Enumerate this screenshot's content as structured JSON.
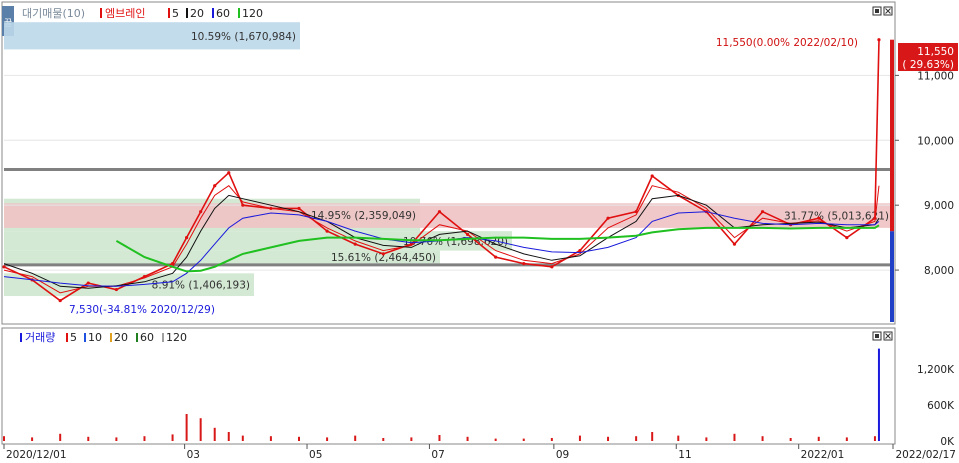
{
  "window": {
    "side_tab": "꿀"
  },
  "price_panel": {
    "legend": {
      "prefix": "대기매물(10)",
      "name": "엠브레인",
      "ma": [
        {
          "label": "5",
          "color": "#e01010"
        },
        {
          "label": "20",
          "color": "#111111"
        },
        {
          "label": "60",
          "color": "#1a1adc"
        },
        {
          "label": "120",
          "color": "#20c020"
        }
      ]
    },
    "y_ticks": [
      "11,000",
      "10,000",
      "9,000",
      "8,000"
    ],
    "current_price": {
      "price": "11,550",
      "change": "( 29.63%)"
    },
    "max_annotation": "11,550(0.00% 2022/02/10)",
    "min_annotation": "7,530(-34.81% 2020/12/29)",
    "volume_profile": [
      {
        "range": [
          11400,
          11820
        ],
        "label": "10.59% (1,670,984)",
        "color": "#bcd8ea"
      },
      {
        "range": [
          8600,
          9100
        ],
        "label": "14.95% (2,359,049)",
        "color": "#cfe7cf"
      },
      {
        "range": [
          8650,
          9030
        ],
        "label": "31.77% (5,013,621)",
        "color": "#f0c2c4"
      },
      {
        "range": [
          8300,
          8600
        ],
        "label": "10.76% (1,698,620)",
        "color": "#cfe7cf"
      },
      {
        "range": [
          8100,
          8300
        ],
        "label": "15.61% (2,464,450)",
        "color": "#cfe7cf"
      },
      {
        "range": [
          7600,
          7950
        ],
        "label": "8.91% (1,406,193)",
        "color": "#cfe7cf"
      }
    ],
    "support_lines": [
      9550,
      8080
    ],
    "price_axis_bar": "#2040c8"
  },
  "volume_panel": {
    "legend": {
      "name": "거래량",
      "ma": [
        {
          "label": "5",
          "color": "#e01010"
        },
        {
          "label": "10",
          "color": "#2050e0"
        },
        {
          "label": "20",
          "color": "#e0a020"
        },
        {
          "label": "60",
          "color": "#208020"
        },
        {
          "label": "120",
          "color": "#a0a0a0"
        }
      ]
    },
    "y_ticks": [
      "1,200K",
      "600K",
      "0K"
    ]
  },
  "x_ticks": [
    "2020/12/01",
    "03",
    "05",
    "07",
    "09",
    "11",
    "2022/01",
    "2022/02/17"
  ],
  "chart_data": {
    "type": "line",
    "title": "엠브레인",
    "ylabel": "",
    "xlabel": "",
    "ylim": [
      7200,
      12100
    ],
    "volume_ylim": [
      0,
      1600000
    ],
    "x": [
      "2020/12/01",
      "2020/12/15",
      "2020/12/29",
      "2021/01/12",
      "2021/01/26",
      "2021/02/09",
      "2021/02/23",
      "2021/03/02",
      "2021/03/09",
      "2021/03/16",
      "2021/03/23",
      "2021/03/30",
      "2021/04/13",
      "2021/04/27",
      "2021/05/11",
      "2021/05/25",
      "2021/06/08",
      "2021/06/22",
      "2021/07/06",
      "2021/07/20",
      "2021/08/03",
      "2021/08/17",
      "2021/08/31",
      "2021/09/14",
      "2021/09/28",
      "2021/10/12",
      "2021/10/20",
      "2021/11/02",
      "2021/11/16",
      "2021/11/30",
      "2021/12/14",
      "2021/12/28",
      "2022/01/11",
      "2022/01/25",
      "2022/02/08",
      "2022/02/10"
    ],
    "series": [
      {
        "name": "엠브레인",
        "color": "#e01010",
        "values": [
          8050,
          7850,
          7530,
          7800,
          7700,
          7900,
          8100,
          8500,
          8900,
          9300,
          9500,
          9000,
          8950,
          8950,
          8600,
          8400,
          8250,
          8400,
          8900,
          8550,
          8200,
          8100,
          8050,
          8300,
          8800,
          8900,
          9450,
          9150,
          8900,
          8400,
          8900,
          8700,
          8800,
          8500,
          8800,
          11550
        ]
      },
      {
        "name": "5",
        "color": "#e01010",
        "values": [
          8000,
          7900,
          7650,
          7750,
          7750,
          7880,
          8050,
          8400,
          8800,
          9150,
          9300,
          9050,
          8950,
          8900,
          8650,
          8450,
          8300,
          8380,
          8700,
          8600,
          8300,
          8150,
          8100,
          8250,
          8650,
          8850,
          9300,
          9200,
          8950,
          8500,
          8800,
          8720,
          8760,
          8600,
          8750,
          9300
        ]
      },
      {
        "name": "20",
        "color": "#111111",
        "values": [
          8100,
          7950,
          7750,
          7720,
          7760,
          7820,
          7950,
          8200,
          8600,
          8950,
          9150,
          9100,
          9000,
          8900,
          8750,
          8500,
          8380,
          8350,
          8550,
          8600,
          8400,
          8250,
          8150,
          8220,
          8500,
          8750,
          9100,
          9150,
          9000,
          8650,
          8700,
          8720,
          8740,
          8650,
          8700,
          8800
        ]
      },
      {
        "name": "60",
        "color": "#1a1adc",
        "values": [
          7900,
          7850,
          7800,
          7760,
          7750,
          7780,
          7820,
          7950,
          8150,
          8400,
          8650,
          8800,
          8880,
          8850,
          8750,
          8600,
          8480,
          8420,
          8450,
          8500,
          8450,
          8350,
          8280,
          8270,
          8350,
          8500,
          8750,
          8880,
          8900,
          8800,
          8720,
          8700,
          8720,
          8700,
          8700,
          8750
        ]
      },
      {
        "name": "120",
        "color": "#20c020",
        "values": [
          null,
          null,
          null,
          null,
          8450,
          8200,
          8050,
          7980,
          7990,
          8050,
          8150,
          8250,
          8350,
          8450,
          8500,
          8500,
          8480,
          8460,
          8460,
          8480,
          8500,
          8500,
          8480,
          8480,
          8500,
          8530,
          8580,
          8630,
          8650,
          8650,
          8650,
          8640,
          8650,
          8650,
          8650,
          8690
        ]
      }
    ],
    "volume": [
      80000,
      60000,
      120000,
      70000,
      60000,
      80000,
      110000,
      450000,
      380000,
      220000,
      150000,
      90000,
      80000,
      70000,
      60000,
      90000,
      50000,
      60000,
      100000,
      70000,
      40000,
      40000,
      50000,
      90000,
      70000,
      80000,
      150000,
      90000,
      60000,
      120000,
      80000,
      50000,
      70000,
      60000,
      80000,
      1540000
    ]
  }
}
